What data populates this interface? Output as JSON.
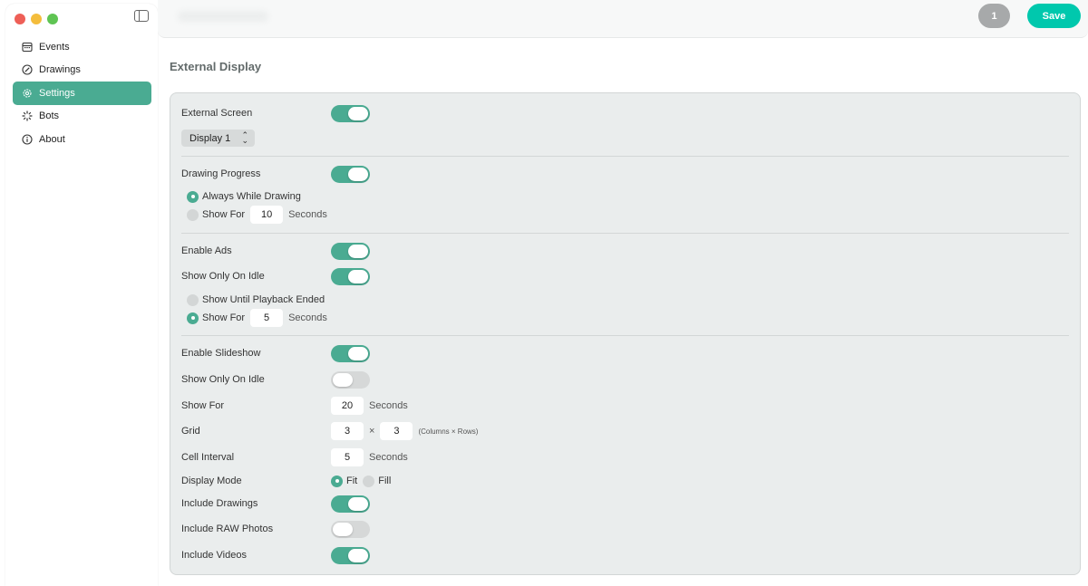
{
  "window": {
    "traffic_lights": [
      "close",
      "minimize",
      "zoom"
    ]
  },
  "sidebar": {
    "items": [
      {
        "label": "Events",
        "icon": "calendar-icon",
        "active": false
      },
      {
        "label": "Drawings",
        "icon": "pencil-circle-icon",
        "active": false
      },
      {
        "label": "Settings",
        "icon": "gear-icon",
        "active": true
      },
      {
        "label": "Bots",
        "icon": "spinner-icon",
        "active": false
      },
      {
        "label": "About",
        "icon": "info-icon",
        "active": false
      }
    ]
  },
  "toolbar": {
    "badge_count": "1",
    "save_label": "Save"
  },
  "section": {
    "title": "External Display"
  },
  "external_screen": {
    "label": "External Screen",
    "on": true,
    "display_select": "Display 1"
  },
  "drawing_progress": {
    "label": "Drawing Progress",
    "on": true,
    "option_always": "Always While Drawing",
    "option_show_for": "Show For",
    "seconds_value": "10",
    "seconds_label": "Seconds",
    "selected": "always"
  },
  "ads": {
    "enable_label": "Enable Ads",
    "enable_on": true,
    "idle_label": "Show Only On Idle",
    "idle_on": true,
    "option_until": "Show Until Playback Ended",
    "option_show_for": "Show For",
    "seconds_value": "5",
    "seconds_label": "Seconds",
    "selected": "show_for"
  },
  "slideshow": {
    "enable_label": "Enable Slideshow",
    "enable_on": true,
    "idle_label": "Show Only On Idle",
    "idle_on": false,
    "show_for_label": "Show For",
    "show_for_value": "20",
    "show_for_suffix": "Seconds",
    "grid_label": "Grid",
    "grid_columns": "3",
    "grid_times": "×",
    "grid_rows": "3",
    "grid_note": "(Columns × Rows)",
    "cell_interval_label": "Cell Interval",
    "cell_interval_value": "5",
    "cell_interval_suffix": "Seconds",
    "display_mode_label": "Display Mode",
    "mode_fit": "Fit",
    "mode_fill": "Fill",
    "mode_selected": "fit",
    "include_drawings_label": "Include Drawings",
    "include_drawings_on": true,
    "include_raw_label": "Include RAW Photos",
    "include_raw_on": false,
    "include_videos_label": "Include Videos",
    "include_videos_on": true
  },
  "colors": {
    "accent": "#4aab92",
    "save_button": "#00c8ad",
    "panel_bg": "#eaeded"
  }
}
